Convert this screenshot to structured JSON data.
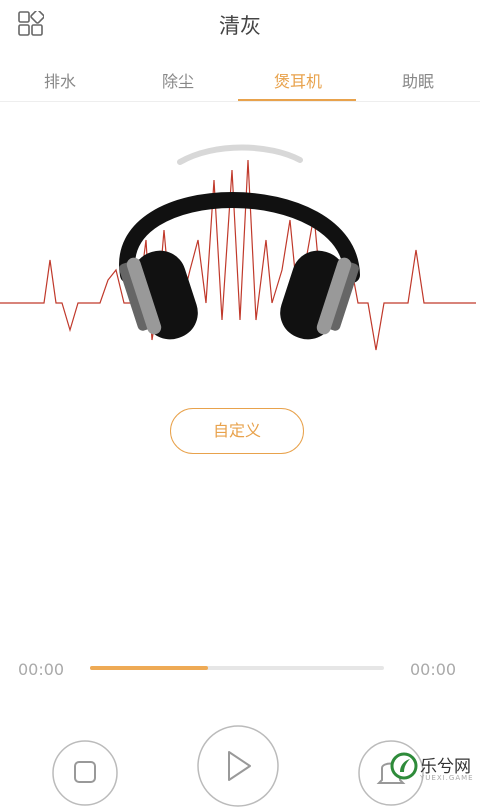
{
  "header": {
    "title": "清灰",
    "menu_icon": "grid-menu-icon"
  },
  "tabs": [
    {
      "label": "排水",
      "active": false
    },
    {
      "label": "除尘",
      "active": false
    },
    {
      "label": "煲耳机",
      "active": true
    },
    {
      "label": "助眠",
      "active": false
    }
  ],
  "hero": {
    "icon": "headphones-icon",
    "wave": "heartbeat-wave"
  },
  "custom_button": {
    "label": "自定义"
  },
  "player": {
    "current_time": "00:00",
    "total_time": "00:00",
    "progress_fraction": 0.4
  },
  "controls": {
    "stop": "stop-icon",
    "play": "play-icon",
    "alarm": "bell-icon"
  },
  "watermark": {
    "text": "乐兮网"
  },
  "colors": {
    "accent": "#e8a24c",
    "wave": "#c0392b",
    "text": "#444444",
    "muted": "#aaaaaa"
  }
}
